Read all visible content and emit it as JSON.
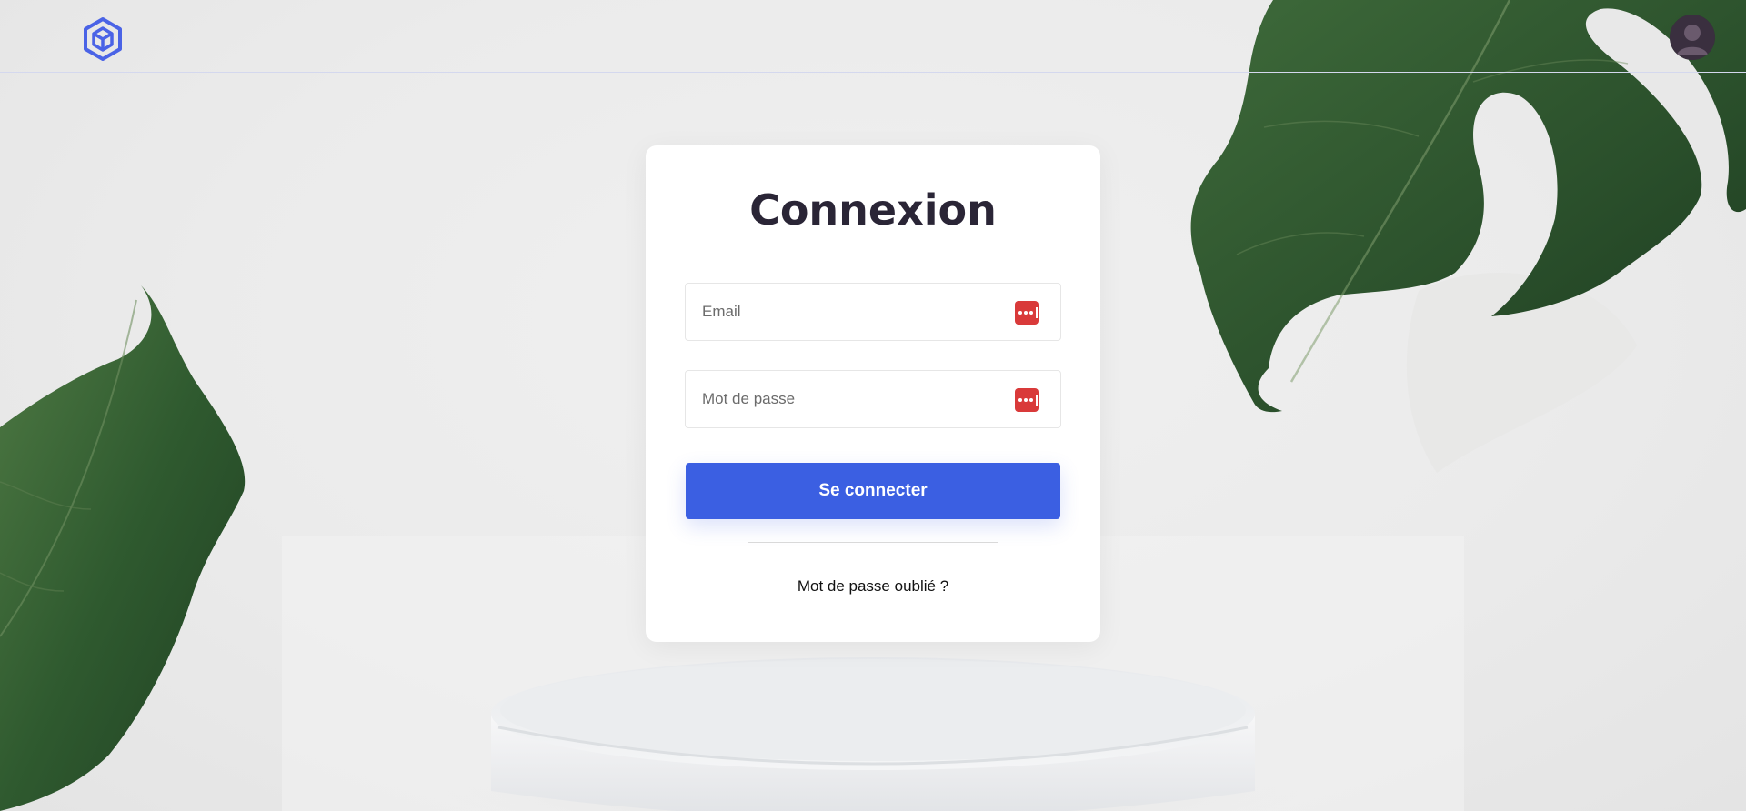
{
  "header": {
    "logo_icon": "hexagon-cube-logo-icon",
    "avatar_icon": "user-avatar-icon"
  },
  "login": {
    "title": "Connexion",
    "email_placeholder": "Email",
    "password_placeholder": "Mot de passe",
    "field_icon": "password-manager-icon",
    "submit_label": "Se connecter",
    "forgot_label": "Mot de passe oublié ?"
  },
  "colors": {
    "accent": "#3b5fe2",
    "logo": "#4a63e6",
    "field_icon": "#d93a3a",
    "title": "#2a2536",
    "leaf": "#2f5a2f"
  }
}
